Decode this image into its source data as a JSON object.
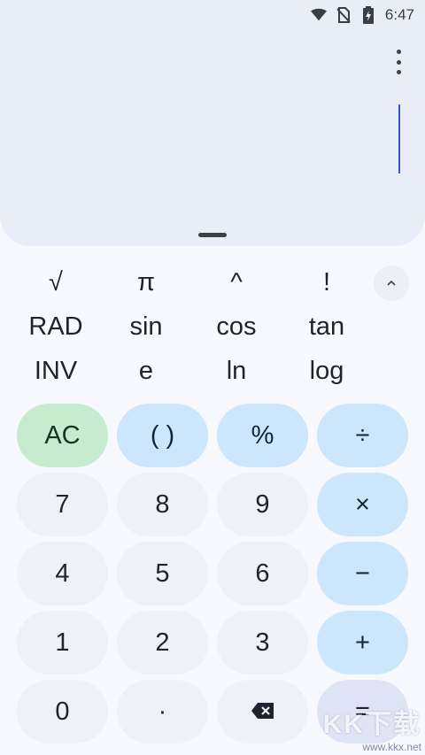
{
  "status_bar": {
    "time": "6:47",
    "icons": [
      "wifi-icon",
      "no-sim-icon",
      "battery-charging-icon"
    ]
  },
  "display": {
    "expression": "",
    "menu_icon": "more-vert-icon"
  },
  "scientific": {
    "rows": [
      [
        "√",
        "π",
        "^",
        "!"
      ],
      [
        "RAD",
        "sin",
        "cos",
        "tan"
      ],
      [
        "INV",
        "e",
        "ln",
        "log"
      ]
    ],
    "collapse_icon": "chevron-up-icon"
  },
  "keypad": {
    "ac": "AC",
    "parens": "( )",
    "percent": "%",
    "divide": "÷",
    "seven": "7",
    "eight": "8",
    "nine": "9",
    "multiply": "×",
    "four": "4",
    "five": "5",
    "six": "6",
    "minus": "−",
    "one": "1",
    "two": "2",
    "three": "3",
    "plus": "+",
    "zero": "0",
    "decimal": "·",
    "backspace_icon": "backspace-icon",
    "equals": "="
  },
  "watermark": {
    "main": "KK下载",
    "sub": "www.kkx.net"
  },
  "colors": {
    "display_bg": "#e9edf8",
    "ac_bg": "#c6ebcf",
    "operator_bg": "#cce6fb",
    "digit_bg": "#eef1f7",
    "cursor": "#3456c8"
  }
}
